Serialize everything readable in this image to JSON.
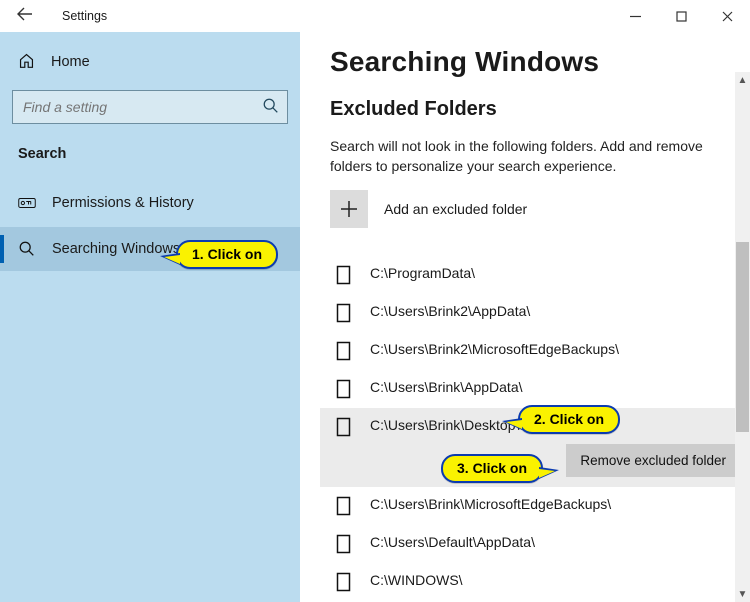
{
  "titlebar": {
    "title": "Settings"
  },
  "sidebar": {
    "home_label": "Home",
    "search_placeholder": "Find a setting",
    "section_label": "Search",
    "items": [
      {
        "label": "Permissions & History"
      },
      {
        "label": "Searching Windows"
      }
    ]
  },
  "main": {
    "heading": "Searching Windows",
    "subheading": "Excluded Folders",
    "description": "Search will not look in the following folders. Add and remove folders to personalize your search experience.",
    "add_label": "Add an excluded folder",
    "remove_label": "Remove excluded folder",
    "folders": [
      "C:\\ProgramData\\",
      "C:\\Users\\Brink2\\AppData\\",
      "C:\\Users\\Brink2\\MicrosoftEdgeBackups\\",
      "C:\\Users\\Brink\\AppData\\",
      "C:\\Users\\Brink\\Desktop\\",
      "C:\\Users\\Brink\\MicrosoftEdgeBackups\\",
      "C:\\Users\\Default\\AppData\\",
      "C:\\WINDOWS\\"
    ],
    "selected_index": 4
  },
  "annotations": {
    "c1": "1. Click on",
    "c2": "2. Click on",
    "c3": "3. Click on"
  }
}
